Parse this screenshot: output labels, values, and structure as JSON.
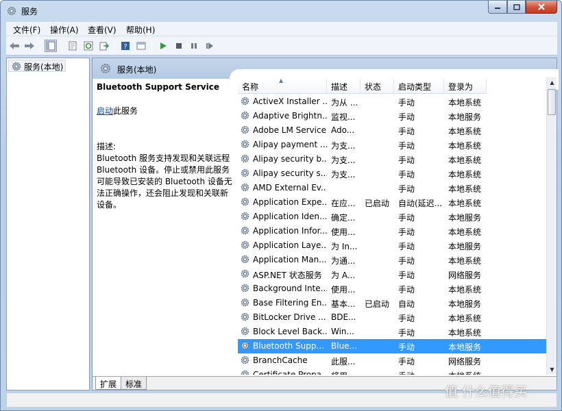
{
  "window": {
    "title": "服务"
  },
  "menu": [
    "文件(F)",
    "操作(A)",
    "查看(V)",
    "帮助(H)"
  ],
  "toolbar": [
    "back-icon",
    "forward-icon",
    "show-hide-tree-icon",
    "properties-icon",
    "refresh-icon",
    "export-icon",
    "help-icon",
    "console-icon",
    "start-icon",
    "stop-icon",
    "pause-icon",
    "restart-icon"
  ],
  "tree": {
    "root": "服务(本地)"
  },
  "header": {
    "title": "服务(本地)"
  },
  "detail": {
    "service_title": "Bluetooth Support Service",
    "start_link": "启动",
    "start_suffix": "此服务",
    "desc_label": "描述:",
    "desc_text": "Bluetooth 服务支持发现和关联远程 Bluetooth 设备。停止或禁用此服务可能导致已安装的 Bluetooth 设备无法正确操作，还会阻止发现和关联新设备。"
  },
  "columns": [
    "名称",
    "描述",
    "状态",
    "启动类型",
    "登录为"
  ],
  "rows": [
    {
      "name": "ActiveX Installer ...",
      "desc": "为从 ...",
      "status": "",
      "startup": "手动",
      "logon": "本地系统"
    },
    {
      "name": "Adaptive Brightn...",
      "desc": "监视...",
      "status": "",
      "startup": "手动",
      "logon": "本地服务"
    },
    {
      "name": "Adobe LM Service",
      "desc": "Ado...",
      "status": "",
      "startup": "手动",
      "logon": "本地系统"
    },
    {
      "name": "Alipay payment ...",
      "desc": "为支...",
      "status": "",
      "startup": "手动",
      "logon": "本地系统"
    },
    {
      "name": "Alipay security b...",
      "desc": "为支...",
      "status": "",
      "startup": "手动",
      "logon": "本地系统"
    },
    {
      "name": "Alipay security s...",
      "desc": "为支...",
      "status": "",
      "startup": "手动",
      "logon": "本地系统"
    },
    {
      "name": "AMD External Ev...",
      "desc": "",
      "status": "",
      "startup": "手动",
      "logon": "本地系统"
    },
    {
      "name": "Application Expe...",
      "desc": "在应...",
      "status": "已启动",
      "startup": "自动(延迟...",
      "logon": "本地系统"
    },
    {
      "name": "Application Iden...",
      "desc": "确定...",
      "status": "",
      "startup": "手动",
      "logon": "本地服务"
    },
    {
      "name": "Application Infor...",
      "desc": "使用...",
      "status": "",
      "startup": "手动",
      "logon": "本地系统"
    },
    {
      "name": "Application Laye...",
      "desc": "为 In...",
      "status": "",
      "startup": "手动",
      "logon": "本地服务"
    },
    {
      "name": "Application Man...",
      "desc": "为通...",
      "status": "",
      "startup": "手动",
      "logon": "本地系统"
    },
    {
      "name": "ASP.NET 状态服务",
      "desc": "为 A...",
      "status": "",
      "startup": "手动",
      "logon": "网络服务"
    },
    {
      "name": "Background Inte...",
      "desc": "使用...",
      "status": "",
      "startup": "手动",
      "logon": "本地系统"
    },
    {
      "name": "Base Filtering En...",
      "desc": "基本...",
      "status": "已启动",
      "startup": "自动",
      "logon": "本地服务"
    },
    {
      "name": "BitLocker Drive ...",
      "desc": "BDE...",
      "status": "",
      "startup": "手动",
      "logon": "本地系统"
    },
    {
      "name": "Block Level Back...",
      "desc": "Win...",
      "status": "",
      "startup": "手动",
      "logon": "本地系统"
    },
    {
      "name": "Bluetooth Supp...",
      "desc": "Blue...",
      "status": "",
      "startup": "手动",
      "logon": "本地服务",
      "selected": true
    },
    {
      "name": "BranchCache",
      "desc": "此服...",
      "status": "",
      "startup": "手动",
      "logon": "网络服务"
    },
    {
      "name": "Certificate Propa...",
      "desc": "将用...",
      "status": "",
      "startup": "手动",
      "logon": "本地系统"
    }
  ],
  "tabs": [
    "扩展",
    "标准"
  ],
  "watermark": "值 什么值得买"
}
